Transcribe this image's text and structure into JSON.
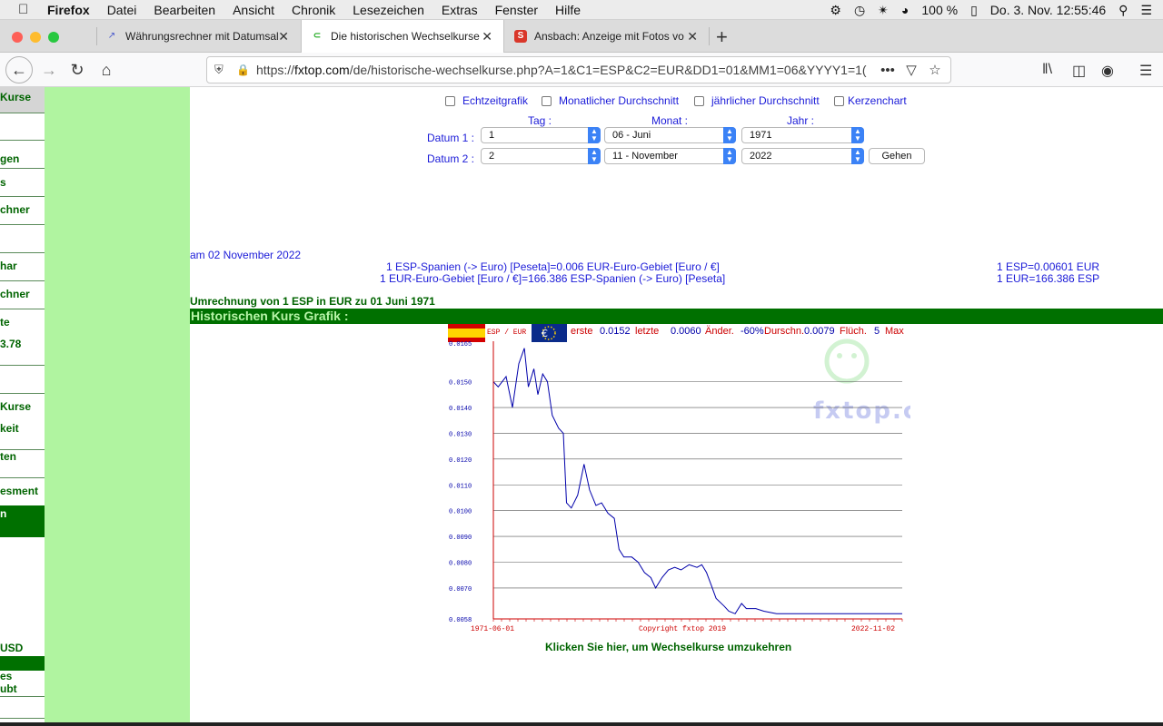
{
  "menubar": {
    "items": [
      "Firefox",
      "Datei",
      "Bearbeiten",
      "Ansicht",
      "Chronik",
      "Lesezeichen",
      "Extras",
      "Fenster",
      "Hilfe"
    ],
    "battery": "100 %",
    "clock": "Do. 3. Nov.  12:55:46"
  },
  "tabs": [
    {
      "title": "Währungsrechner mit Datumsal",
      "icon": "chart-icon"
    },
    {
      "title": "Die historischen Wechselkurse",
      "icon": "fxtop-icon"
    },
    {
      "title": "Ansbach: Anzeige mit Fotos vo",
      "icon": "s-icon"
    }
  ],
  "url": {
    "prefix": "https://",
    "host": "fxtop.com",
    "path": "/de/historische-wechselkurse.php?A=1&C1=ESP&C2=EUR&DD1=01&MM1=06&YYYY1=1("
  },
  "sidebar": {
    "items": [
      "Kurse",
      "gen",
      "s",
      "chner",
      "har",
      "chner",
      "te",
      "3.78",
      "Kurse",
      "keit",
      "ten",
      "esment",
      "n",
      "USD",
      "es",
      "ubt"
    ]
  },
  "form": {
    "checkboxes": [
      "Echtzeitgrafik",
      "Monatlicher Durchschnitt",
      "jährlicher Durchschnitt",
      "Kerzenchart"
    ],
    "col_tag": "Tag :",
    "col_monat": "Monat :",
    "col_jahr": "Jahr :",
    "datum1_label": "Datum 1 :",
    "datum2_label": "Datum 2 :",
    "d1_tag": "1",
    "d1_monat": "06 - Juni",
    "d1_jahr": "1971",
    "d2_tag": "2",
    "d2_monat": "11 - November",
    "d2_jahr": "2022",
    "go": "Gehen"
  },
  "rates": {
    "date_line": "am 02 November 2022",
    "line1": "1 ESP-Spanien (-> Euro) [Peseta]=0.006 EUR-Euro-Gebiet [Euro / €]",
    "line2": "1 EUR-Euro-Gebiet [Euro / €]=166.386 ESP-Spanien (-> Euro) [Peseta]",
    "right1": "1 ESP=0.00601 EUR",
    "right2": "1 EUR=166.386 ESP"
  },
  "conversion_title": "Umrechnung von 1 ESP in EUR zu 01 Juni 1971",
  "history_title": "Historischen Kurs Grafik :",
  "chart_header": {
    "pair": "ESP / EUR",
    "erste_label": "erste",
    "erste_value": "0.0152",
    "letzte_label": "letzte",
    "letzte_value": "0.0060",
    "aender_label": "Änder.",
    "aender_value": "-60%",
    "durch_label": "Durschn.",
    "durch_value": "0.0079",
    "fluch_label": "Flüch.",
    "fluch_value": "5",
    "max_label": "Max"
  },
  "chart_data": {
    "type": "line",
    "ylabel": "",
    "xlabel": "",
    "ylim": [
      0.0058,
      0.0165
    ],
    "y_ticks": [
      "0.0165",
      "0.0150",
      "0.0140",
      "0.0130",
      "0.0120",
      "0.0110",
      "0.0100",
      "0.0090",
      "0.0080",
      "0.0070",
      "0.0058"
    ],
    "x_tick_labels": [
      "1971-06-01",
      "2022-11-02"
    ],
    "copyright": "Copyright fxtop 2019",
    "watermark": "fxtop.com",
    "series": [
      {
        "values": [
          {
            "x": 1971.4,
            "y": 0.015
          },
          {
            "x": 1972.0,
            "y": 0.0148
          },
          {
            "x": 1973.0,
            "y": 0.0152
          },
          {
            "x": 1973.8,
            "y": 0.014
          },
          {
            "x": 1974.6,
            "y": 0.0157
          },
          {
            "x": 1975.3,
            "y": 0.0163
          },
          {
            "x": 1975.8,
            "y": 0.0148
          },
          {
            "x": 1976.5,
            "y": 0.0155
          },
          {
            "x": 1977.0,
            "y": 0.0145
          },
          {
            "x": 1977.6,
            "y": 0.0153
          },
          {
            "x": 1978.2,
            "y": 0.015
          },
          {
            "x": 1978.8,
            "y": 0.0137
          },
          {
            "x": 1979.6,
            "y": 0.0132
          },
          {
            "x": 1980.2,
            "y": 0.013
          },
          {
            "x": 1980.6,
            "y": 0.0103
          },
          {
            "x": 1981.2,
            "y": 0.0101
          },
          {
            "x": 1982.0,
            "y": 0.0106
          },
          {
            "x": 1982.8,
            "y": 0.0118
          },
          {
            "x": 1983.5,
            "y": 0.0108
          },
          {
            "x": 1984.3,
            "y": 0.0102
          },
          {
            "x": 1985.0,
            "y": 0.0103
          },
          {
            "x": 1985.8,
            "y": 0.0099
          },
          {
            "x": 1986.6,
            "y": 0.0097
          },
          {
            "x": 1987.2,
            "y": 0.0085
          },
          {
            "x": 1987.8,
            "y": 0.0082
          },
          {
            "x": 1988.8,
            "y": 0.0082
          },
          {
            "x": 1989.6,
            "y": 0.008
          },
          {
            "x": 1990.4,
            "y": 0.0076
          },
          {
            "x": 1991.2,
            "y": 0.0074
          },
          {
            "x": 1991.8,
            "y": 0.007
          },
          {
            "x": 1992.6,
            "y": 0.0074
          },
          {
            "x": 1993.4,
            "y": 0.0077
          },
          {
            "x": 1994.2,
            "y": 0.0078
          },
          {
            "x": 1995.0,
            "y": 0.0077
          },
          {
            "x": 1996.0,
            "y": 0.0079
          },
          {
            "x": 1997.0,
            "y": 0.0078
          },
          {
            "x": 1997.6,
            "y": 0.0079
          },
          {
            "x": 1998.2,
            "y": 0.0076
          },
          {
            "x": 1998.8,
            "y": 0.0071
          },
          {
            "x": 1999.4,
            "y": 0.0066
          },
          {
            "x": 2000.4,
            "y": 0.0063
          },
          {
            "x": 2001.0,
            "y": 0.0061
          },
          {
            "x": 2001.8,
            "y": 0.006
          },
          {
            "x": 2002.6,
            "y": 0.0064
          },
          {
            "x": 2003.2,
            "y": 0.0062
          },
          {
            "x": 2004.4,
            "y": 0.0062
          },
          {
            "x": 2005.4,
            "y": 0.0061
          },
          {
            "x": 2007.0,
            "y": 0.006
          },
          {
            "x": 2009.0,
            "y": 0.006
          },
          {
            "x": 2015.0,
            "y": 0.006
          },
          {
            "x": 2022.8,
            "y": 0.006
          }
        ]
      }
    ],
    "xlim": [
      1971.4,
      2022.8
    ],
    "grid": true
  },
  "click_link": "Klicken Sie hier, um Wechselkurse umzukehren",
  "colors": {
    "page_green_band": "#b0f4a0",
    "dark_green": "#007000",
    "link_blue": "#1b1bd8",
    "chart_line": "#0000aa",
    "chart_axis": "#cc0000"
  }
}
